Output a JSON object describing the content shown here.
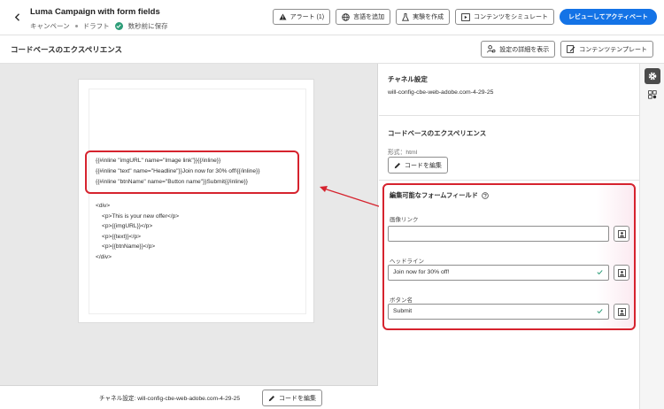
{
  "header": {
    "title": "Luma Campaign with form fields",
    "type": "キャンペーン",
    "status": "ドラフト",
    "saved": "数秒前に保存",
    "buttons": {
      "alerts": "アラート (1)",
      "add_language": "言語を追加",
      "create_experiment": "実験を作成",
      "simulate": "コンテンツをシミュレート",
      "review_activate": "レビューしてアクティベート"
    }
  },
  "section": {
    "title": "コードベースのエクスペリエンス",
    "show_details": "設定の詳細を表示",
    "content_template": "コンテンツテンプレート"
  },
  "code": {
    "highlighted": [
      "{{#inline \"imgURL\" name=\"Image link\"}}{{/inline}}",
      "{{#inline \"text\" name=\"Headline\"}}Join now for 30% off!{{/inline}}",
      "{{#inline \"btnName\" name=\"Button name\"}}Submit{{/inline}}"
    ],
    "lines": [
      "<div>",
      "<p>This is your new offer</p>",
      "<p>{{imgURL}}</p>",
      "<p>{{text}}</p>",
      "<p>{{btnName}}</p>",
      "</div>"
    ]
  },
  "footer": {
    "channel_label": "チャネル設定:",
    "channel_value": "will-config-cbe-web-adobe.com-4-29-25",
    "edit_code": "コードを編集"
  },
  "panel": {
    "channel_title": "チャネル設定",
    "channel_value": "will-config-cbe-web-adobe.com-4-29-25",
    "experience_title": "コードベースのエクスペリエンス",
    "format": "形式：html",
    "edit_code": "コードを編集",
    "fields_title": "編集可能なフォームフィールド",
    "fields": [
      {
        "label": "画像リンク",
        "value": ""
      },
      {
        "label": "ヘッドライン",
        "value": "Join now for 30% off!"
      },
      {
        "label": "ボタン名",
        "value": "Submit"
      }
    ]
  },
  "colors": {
    "accent": "#1473e6",
    "highlight": "#d6232e",
    "success": "#2d9d78"
  }
}
